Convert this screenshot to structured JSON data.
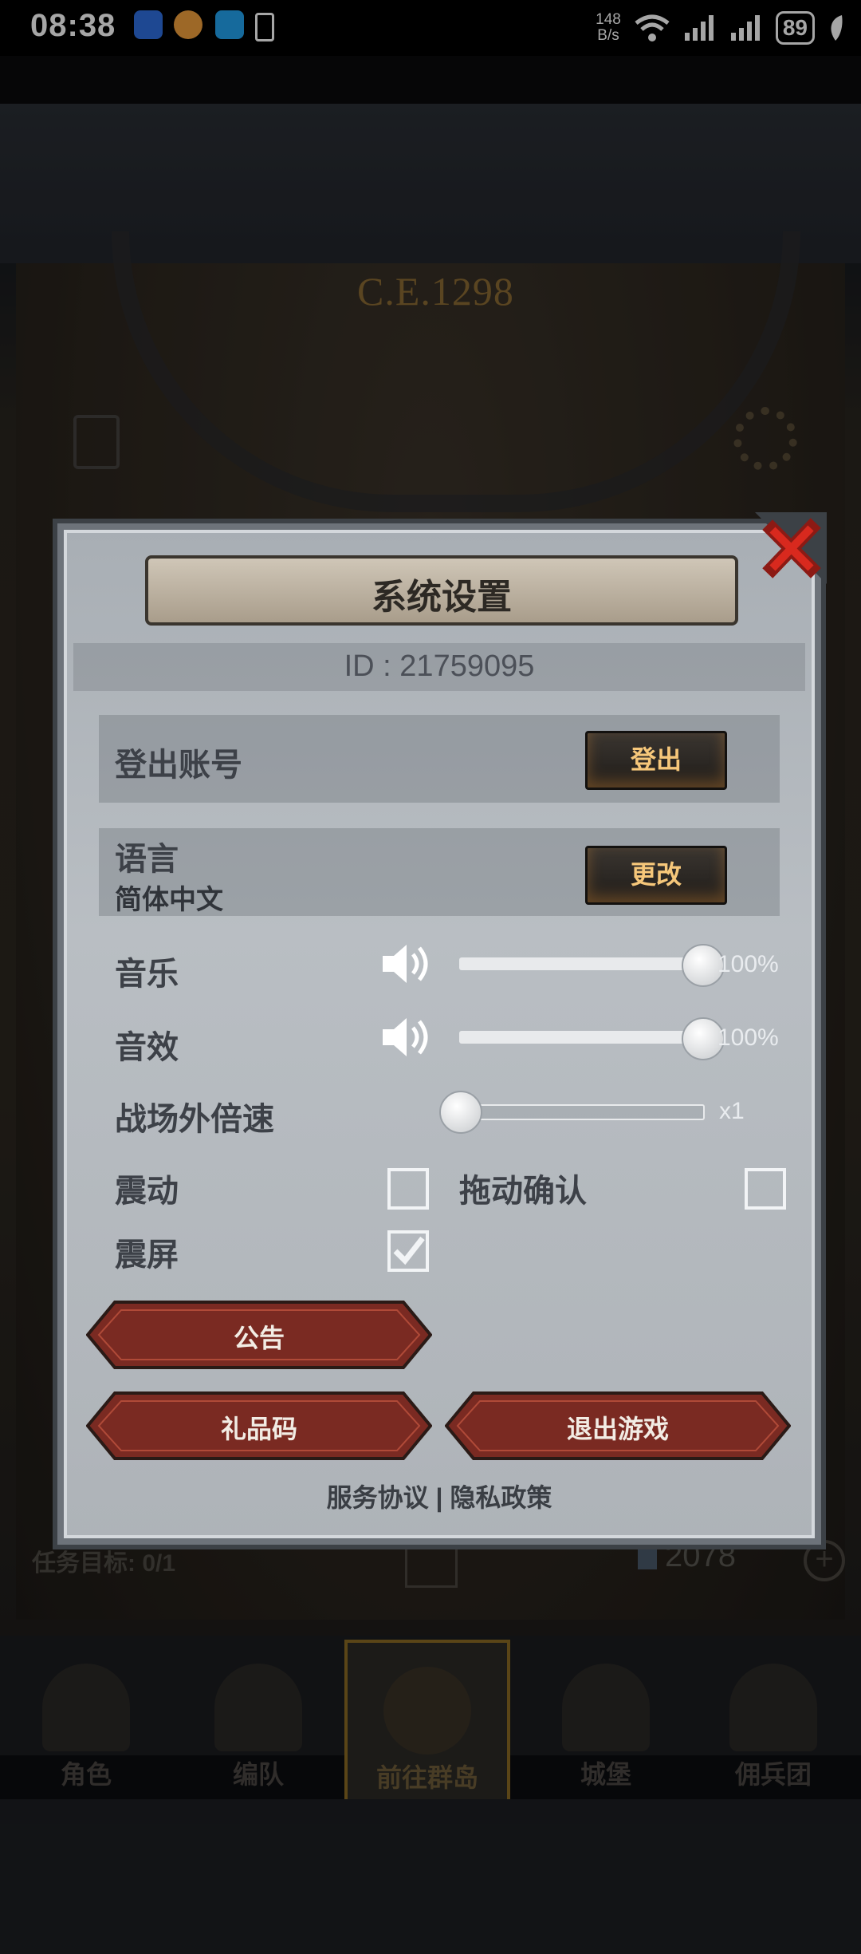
{
  "status_bar": {
    "time": "08:38",
    "net_speed_value": "148",
    "net_speed_unit": "B/s",
    "battery": "89",
    "icons": [
      "bluetooth-icon",
      "browser-icon",
      "search-app-icon",
      "vibrate-icon",
      "wifi-icon",
      "signal-icon",
      "signal-icon",
      "leaf-icon"
    ]
  },
  "game": {
    "era": "C.E.1298",
    "task_label": "任务目标: 0/1",
    "gems": "2078",
    "nav": [
      {
        "label": "角色"
      },
      {
        "label": "编队"
      },
      {
        "label": "前往群岛"
      },
      {
        "label": "城堡"
      },
      {
        "label": "佣兵团"
      }
    ]
  },
  "dialog": {
    "title": "系统设置",
    "id_text": "ID : 21759095",
    "logout": {
      "label": "登出账号",
      "button": "登出"
    },
    "language": {
      "label": "语言",
      "value": "简体中文",
      "button": "更改"
    },
    "music": {
      "label": "音乐",
      "percent_text": "100%",
      "level": 1.0
    },
    "sfx": {
      "label": "音效",
      "percent_text": "100%",
      "level": 1.0
    },
    "speed": {
      "label": "战场外倍速",
      "value_text": "x1",
      "level": 0.0
    },
    "vibration": {
      "label": "震动",
      "checked": false
    },
    "drag_confirm": {
      "label": "拖动确认",
      "checked": false
    },
    "screen_shake": {
      "label": "震屏",
      "checked": true
    },
    "buttons": {
      "announcement": "公告",
      "gift_code": "礼品码",
      "quit": "退出游戏"
    },
    "links": {
      "terms": "服务协议",
      "separator": " | ",
      "privacy": "隐私政策"
    }
  },
  "colors": {
    "button_text": "#f6c77a",
    "red_button": "#7a2a22",
    "close_red": "#c5241b"
  }
}
